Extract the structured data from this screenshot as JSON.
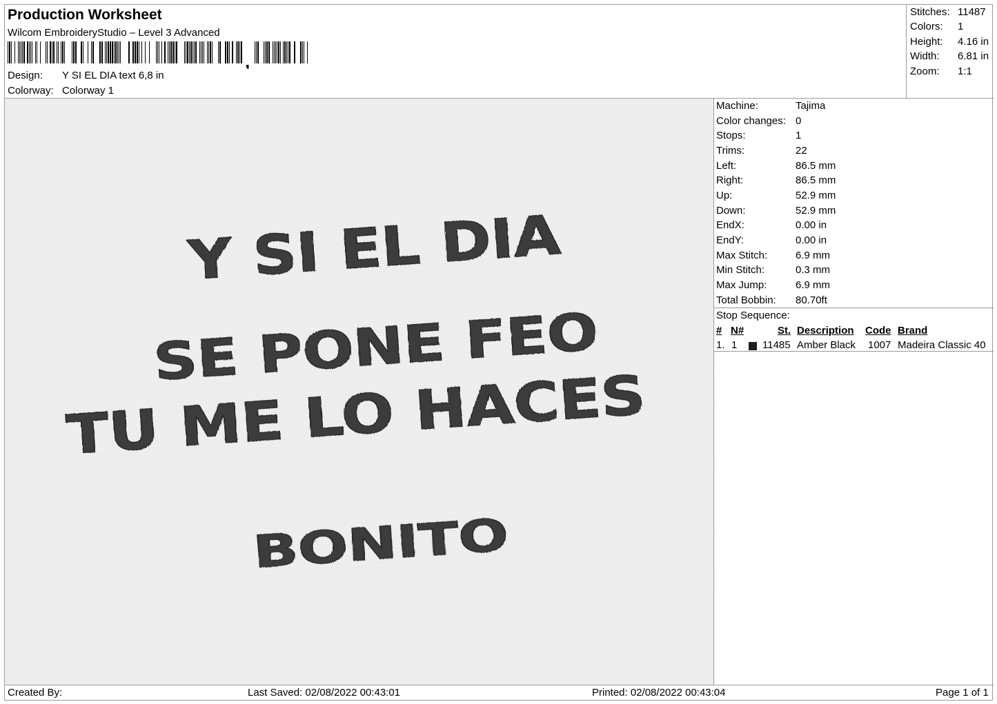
{
  "header": {
    "title": "Production Worksheet",
    "software": "Wilcom EmbroideryStudio – Level 3 Advanced",
    "design_label": "Design:",
    "design_value": "Y SI EL DIA  text 6,8 in",
    "colorway_label": "Colorway:",
    "colorway_value": "Colorway 1"
  },
  "summary": {
    "stitches_label": "Stitches:",
    "stitches": "11487",
    "colors_label": "Colors:",
    "colors": "1",
    "height_label": "Height:",
    "height": "4.16 in",
    "width_label": "Width:",
    "width": "6.81 in",
    "zoom_label": "Zoom:",
    "zoom": "1:1"
  },
  "design_text": {
    "line1": "Y SI EL DIA",
    "line2": "SE PONE  FEO",
    "line3": "TU ME LO HACES",
    "line4": "BONITO",
    "thread_color": "#3b3d3a",
    "fabric_color": "#ebebeb"
  },
  "machine": {
    "machine_label": "Machine:",
    "machine": "Tajima",
    "color_changes_label": "Color changes:",
    "color_changes": "0",
    "stops_label": "Stops:",
    "stops": "1",
    "trims_label": "Trims:",
    "trims": "22",
    "left_label": "Left:",
    "left": "86.5 mm",
    "right_label": "Right:",
    "right": "86.5 mm",
    "up_label": "Up:",
    "up": "52.9 mm",
    "down_label": "Down:",
    "down": "52.9 mm",
    "endx_label": "EndX:",
    "endx": "0.00 in",
    "endy_label": "EndY:",
    "endy": "0.00 in",
    "max_stitch_label": "Max Stitch:",
    "max_stitch": "6.9 mm",
    "min_stitch_label": "Min Stitch:",
    "min_stitch": "0.3 mm",
    "max_jump_label": "Max Jump:",
    "max_jump": "6.9 mm",
    "total_bobbin_label": "Total Bobbin:",
    "total_bobbin": "80.70ft"
  },
  "stop_sequence": {
    "caption": "Stop Sequence:",
    "headers": {
      "num": "#",
      "n": "N#",
      "st": "St.",
      "description": "Description",
      "code": "Code",
      "brand": "Brand"
    },
    "rows": [
      {
        "num": "1.",
        "n": "1",
        "swatch": "#1e1e1e",
        "st": "11485",
        "description": "Amber Black",
        "code": "1007",
        "brand": "Madeira Classic 40"
      }
    ]
  },
  "footer": {
    "created_by": "Created By:",
    "last_saved": "Last Saved: 02/08/2022 00:43:01",
    "printed": "Printed: 02/08/2022 00:43:04",
    "page": "Page 1 of 1"
  }
}
